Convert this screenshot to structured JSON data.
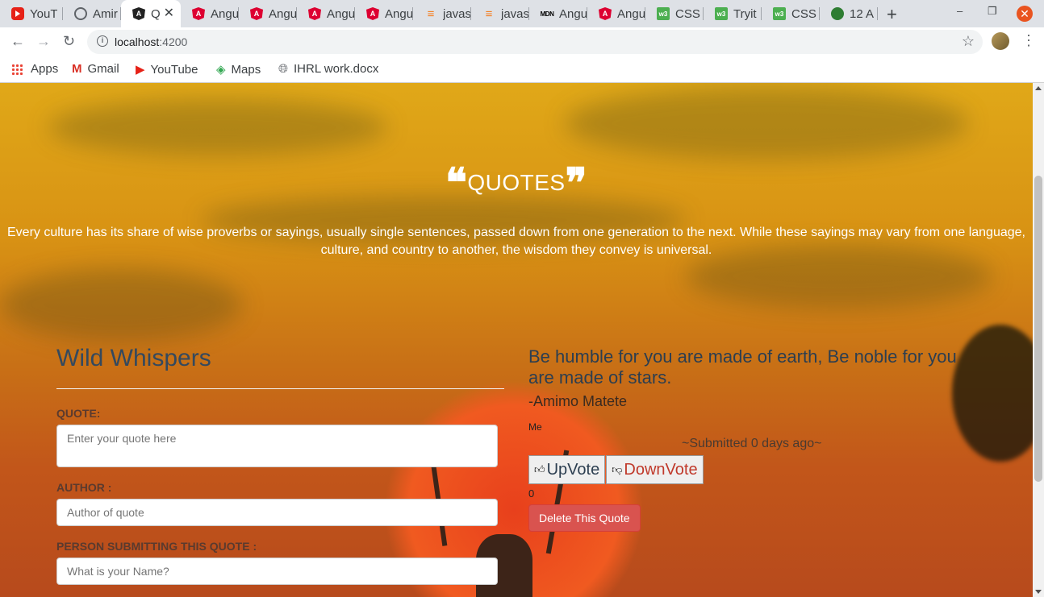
{
  "browser": {
    "tabs": [
      {
        "title": "YouT",
        "icon": "youtube-icon"
      },
      {
        "title": "Amir",
        "icon": "github-icon"
      },
      {
        "title": "Q",
        "icon": "angular-dark-icon"
      },
      {
        "title": "Angu",
        "icon": "angular-icon"
      },
      {
        "title": "Angu",
        "icon": "angular-icon"
      },
      {
        "title": "Angu",
        "icon": "angular-icon"
      },
      {
        "title": "Angu",
        "icon": "angular-icon"
      },
      {
        "title": "javas",
        "icon": "stackoverflow-icon"
      },
      {
        "title": "javas",
        "icon": "stackoverflow-icon"
      },
      {
        "title": "Angu",
        "icon": "mdn-icon"
      },
      {
        "title": "Angu",
        "icon": "angular-icon"
      },
      {
        "title": "CSS I",
        "icon": "w3schools-icon"
      },
      {
        "title": "Tryit",
        "icon": "w3schools-icon"
      },
      {
        "title": "CSS I",
        "icon": "w3schools-icon"
      },
      {
        "title": "12 A",
        "icon": "site-icon"
      }
    ],
    "url_host": "localhost",
    "url_port": ":4200",
    "bookmarks": [
      {
        "label": "Apps",
        "icon": "apps-grid-icon"
      },
      {
        "label": "Gmail",
        "icon": "gmail-icon"
      },
      {
        "label": "YouTube",
        "icon": "youtube-icon"
      },
      {
        "label": "Maps",
        "icon": "maps-icon"
      },
      {
        "label": "IHRL work.docx",
        "icon": "globe-icon"
      }
    ]
  },
  "hero": {
    "title": "QUOTES",
    "subtitle": "Every culture has its share of wise proverbs or sayings, usually single sentences, passed down from one generation to the next. While these sayings may vary from one language, culture, and country to another, the wisdom they convey is universal."
  },
  "form": {
    "app_name": "Wild Whispers",
    "quote_label": "QUOTE:",
    "quote_placeholder": "Enter your quote here",
    "author_label": "AUTHOR :",
    "author_placeholder": "Author of quote",
    "submitter_label": "PERSON SUBMITTING THIS QUOTE :",
    "submitter_placeholder": "What is your Name?"
  },
  "quote": {
    "text": "Be humble for you are made of earth, Be noble for you are made of stars.",
    "author": "-Amimo Matete",
    "submitter": "Me",
    "submitted": "~Submitted 0 days ago~",
    "upvote_label": "UpVote",
    "downvote_label": "DownVote",
    "votes": "0",
    "delete_label": "Delete This Quote"
  }
}
